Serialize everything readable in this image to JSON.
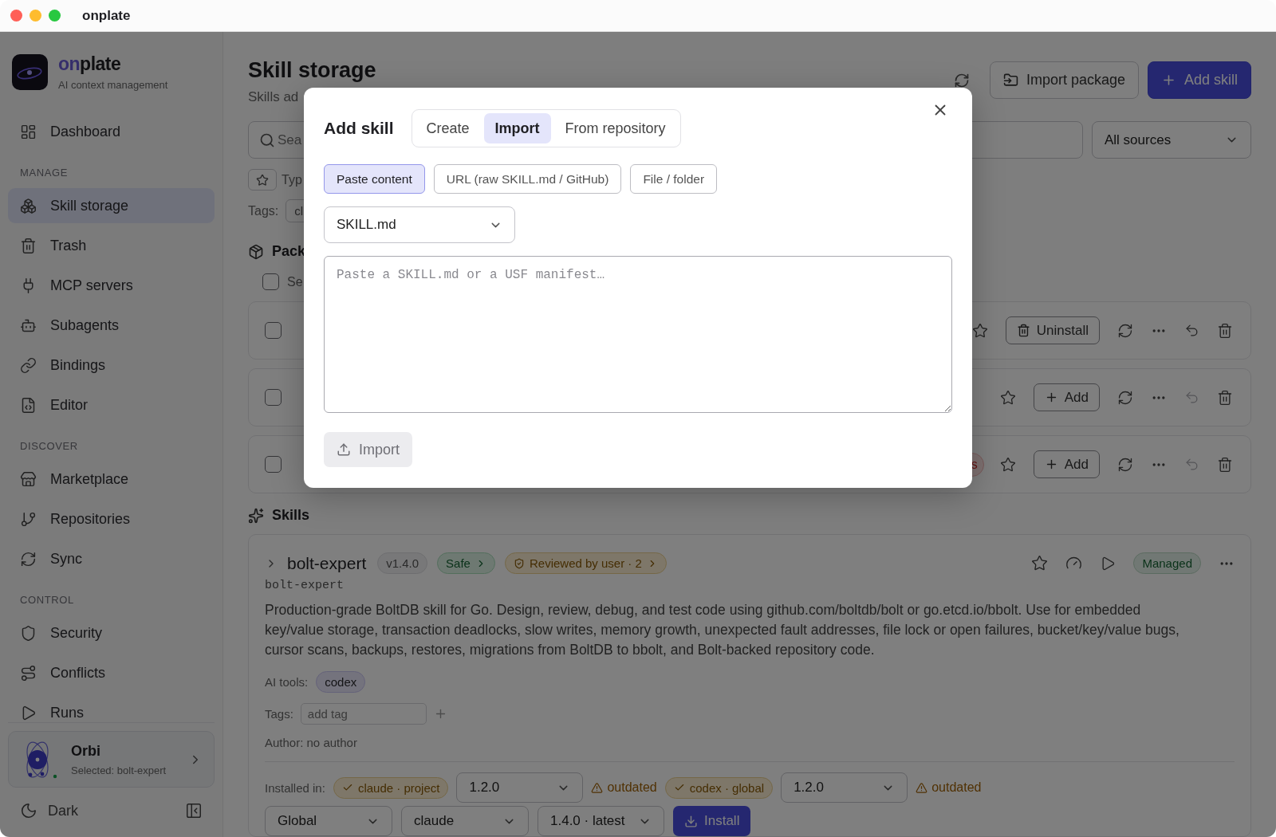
{
  "window": {
    "title": "onplate"
  },
  "sidebar": {
    "brand": {
      "accent": "on",
      "rest": "plate",
      "tagline": "AI context management"
    },
    "groups": [
      {
        "items": [
          {
            "label": "Dashboard",
            "selected": false
          }
        ]
      },
      {
        "heading": "MANAGE",
        "items": [
          {
            "label": "Skill storage",
            "selected": true
          },
          {
            "label": "Trash",
            "selected": false
          },
          {
            "label": "MCP servers",
            "selected": false
          },
          {
            "label": "Subagents",
            "selected": false
          },
          {
            "label": "Bindings",
            "selected": false
          },
          {
            "label": "Editor",
            "selected": false
          }
        ]
      },
      {
        "heading": "DISCOVER",
        "items": [
          {
            "label": "Marketplace",
            "selected": false
          },
          {
            "label": "Repositories",
            "selected": false
          },
          {
            "label": "Sync",
            "selected": false
          }
        ]
      },
      {
        "heading": "CONTROL",
        "items": [
          {
            "label": "Security",
            "selected": false
          },
          {
            "label": "Conflicts",
            "selected": false
          },
          {
            "label": "Runs",
            "selected": false
          }
        ]
      }
    ],
    "assistant": {
      "name": "Orbi",
      "status": "Selected: bolt-expert"
    },
    "theme": {
      "label": "Dark"
    }
  },
  "main": {
    "title": "Skill storage",
    "subtitle": "Skills ad",
    "actions": [
      {
        "label": "Import package",
        "kind": "secondary"
      },
      {
        "label": "Add skill",
        "kind": "primary"
      }
    ],
    "search": {
      "placeholder": "Sea"
    },
    "source_filter": {
      "value": "All sources"
    },
    "type_label": "Typ",
    "tags": {
      "label": "Tags:",
      "chips": [
        "cl"
      ]
    },
    "packages": {
      "heading": "Pack",
      "select_all": {
        "label": "Se",
        "checked": false
      },
      "rows": [
        {
          "checked": false,
          "action": {
            "label": "Uninstall",
            "kind": "uninstall"
          },
          "undo_enabled": true
        },
        {
          "checked": false,
          "action": {
            "label": "Add",
            "kind": "add"
          },
          "undo_enabled": false
        },
        {
          "checked": false,
          "badge": "s",
          "action": {
            "label": "Add",
            "kind": "add"
          },
          "undo_enabled": false
        }
      ]
    },
    "skills": {
      "heading": "Skills",
      "items": [
        {
          "name": "bolt-expert",
          "version": "v1.4.0",
          "safety": "Safe",
          "review": "Reviewed by user · 2",
          "status": "Managed",
          "slug": "bolt-expert",
          "description": "Production-grade BoltDB skill for Go. Design, review, debug, and test code using github.com/boltdb/bolt or go.etcd.io/bbolt. Use for embedded key/value storage, transaction deadlocks, slow writes, memory growth, unexpected fault addresses, file lock or open failures, bucket/key/value bugs, cursor scans, backups, restores, migrations from BoltDB to bbolt, and Bolt-backed repository code.",
          "ai_tools_label": "AI tools:",
          "ai_tools": [
            "codex"
          ],
          "tags_label": "Tags:",
          "tag_placeholder": "add tag",
          "author": "Author: no author",
          "installed_label": "Installed in:",
          "installs": [
            {
              "target": "claude · project",
              "version": "1.2.0",
              "status": "outdated"
            },
            {
              "target": "codex · global",
              "version": "1.2.0",
              "status": "outdated"
            }
          ],
          "install_row": {
            "scope": "Global",
            "tool": "claude",
            "version": "1.4.0 · latest",
            "button": "Install"
          }
        }
      ]
    }
  },
  "modal": {
    "title": "Add skill",
    "tabs": [
      {
        "label": "Create",
        "selected": false
      },
      {
        "label": "Import",
        "selected": true
      },
      {
        "label": "From repository",
        "selected": false
      }
    ],
    "sources": [
      {
        "label": "Paste content",
        "selected": true
      },
      {
        "label": "URL (raw SKILL.md / GitHub)",
        "selected": false
      },
      {
        "label": "File / folder",
        "selected": false
      }
    ],
    "format": {
      "value": "SKILL.md"
    },
    "content": {
      "placeholder": "Paste a SKILL.md or a USF manifest…"
    },
    "submit": {
      "label": "Import",
      "disabled": true
    }
  }
}
